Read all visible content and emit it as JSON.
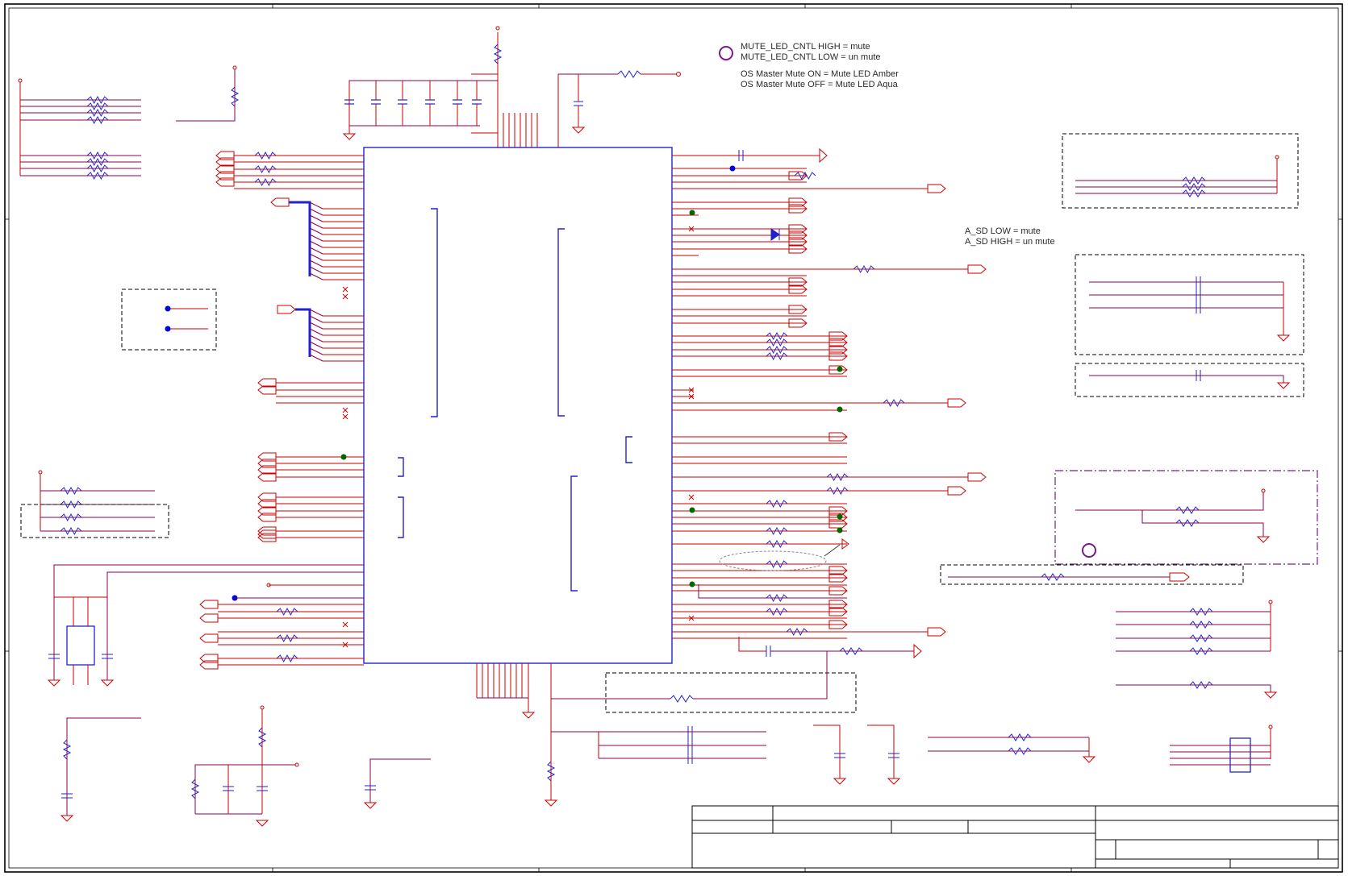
{
  "notes": {
    "mute_led": [
      "MUTE_LED_CNTL HIGH = mute",
      "MUTE_LED_CNTL LOW = un mute",
      "OS Master Mute ON = Mute LED Amber",
      "OS Master Mute OFF = Mute LED Aqua"
    ],
    "amp_sd": [
      "A_SD LOW = mute",
      "A_SD HIGH = un mute"
    ]
  },
  "colors": {
    "wire": "#cc0000",
    "net": "#8b0050",
    "component": "#2222cc",
    "junction": "#006600",
    "dot": "#0000dd",
    "border": "#000000",
    "dashed_box": "#000000",
    "purple": "#7a1a8a"
  }
}
